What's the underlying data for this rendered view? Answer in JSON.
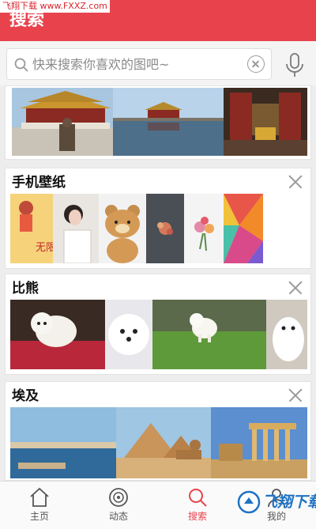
{
  "watermark": "飞翔下载 www.FXXZ.com",
  "header": {
    "title": "搜索"
  },
  "search": {
    "placeholder": "快来搜索你喜欢的图吧~"
  },
  "sections": [
    {
      "title": "手机壁纸"
    },
    {
      "title": "比熊"
    },
    {
      "title": "埃及"
    }
  ],
  "wallpaper_text": "无限",
  "bottom_nav": [
    {
      "label": "主页",
      "icon": "home-icon"
    },
    {
      "label": "动态",
      "icon": "activity-icon"
    },
    {
      "label": "搜索",
      "icon": "search-icon",
      "active": true
    },
    {
      "label": "我的",
      "icon": "profile-icon"
    }
  ],
  "download_badge": "飞翔下载",
  "colors": {
    "accent": "#e8434d",
    "badge": "#1f73c4"
  }
}
